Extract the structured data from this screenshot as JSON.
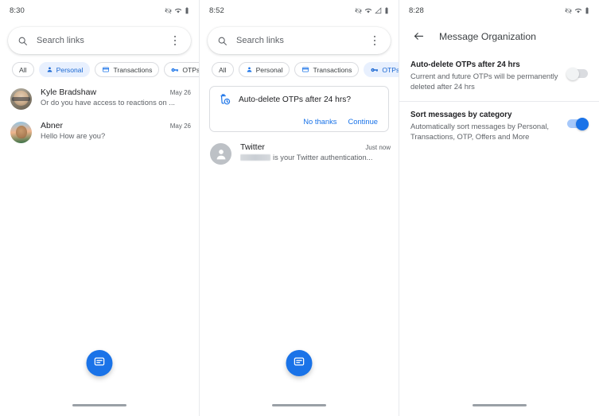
{
  "panels": [
    {
      "status": {
        "time": "8:30",
        "icons": [
          "vibrate-off-icon",
          "wifi-icon",
          "battery-icon"
        ]
      },
      "search": {
        "placeholder": "Search links",
        "value": "",
        "overflow": "more-options"
      },
      "chips": [
        {
          "label": "All",
          "icon": null,
          "selected": false
        },
        {
          "label": "Personal",
          "icon": "person-icon",
          "selected": true
        },
        {
          "label": "Transactions",
          "icon": "credit-card-icon",
          "selected": false
        },
        {
          "label": "OTPs",
          "icon": "key-icon",
          "selected": false
        }
      ],
      "conversations": [
        {
          "name": "Kyle Bradshaw",
          "snippet": "Or do you have access to reactions on ...",
          "time": "May 26",
          "avatar": "photo-kyle"
        },
        {
          "name": "Abner",
          "snippet": "Hello How are you?",
          "time": "May 26",
          "avatar": "photo-abner"
        }
      ],
      "fab": "compose-message-icon"
    },
    {
      "status": {
        "time": "8:52",
        "icons": [
          "vibrate-off-icon",
          "wifi-icon",
          "signal-icon",
          "battery-icon"
        ]
      },
      "search": {
        "placeholder": "Search links",
        "value": "",
        "overflow": "more-options"
      },
      "chips": [
        {
          "label": "All",
          "icon": null,
          "selected": false
        },
        {
          "label": "Personal",
          "icon": "person-icon",
          "selected": false
        },
        {
          "label": "Transactions",
          "icon": "credit-card-icon",
          "selected": false
        },
        {
          "label": "OTPs",
          "icon": "key-icon",
          "selected": true
        }
      ],
      "promo": {
        "icon": "auto-delete-icon",
        "title": "Auto-delete OTPs after 24 hrs?",
        "dismiss_label": "No thanks",
        "confirm_label": "Continue"
      },
      "conversations": [
        {
          "name": "Twitter",
          "snippet_redacted": true,
          "snippet": "is your Twitter authentication...",
          "time": "Just now",
          "avatar": "generic-person"
        }
      ],
      "fab": "compose-message-icon"
    },
    {
      "status": {
        "time": "8:28",
        "icons": [
          "vibrate-off-icon",
          "wifi-icon",
          "battery-icon"
        ]
      },
      "appbar": {
        "back_icon": "arrow-back-icon",
        "title": "Message Organization"
      },
      "settings": [
        {
          "title": "Auto-delete OTPs after 24 hrs",
          "subtitle": "Current and future OTPs will be permanently deleted after 24 hrs",
          "toggle_state": "off"
        },
        {
          "title": "Sort messages by category",
          "subtitle": "Automatically sort messages by Personal, Transactions, OTP, Offers and More",
          "toggle_state": "on"
        }
      ]
    }
  ],
  "colors": {
    "accent": "#1a73e8",
    "chip_selected_bg": "#e8f0fe",
    "chip_selected_text": "#1967d2",
    "toggle_on_track": "#a6c8fa",
    "toggle_off_track": "#dadce0",
    "text_primary": "#202124",
    "text_secondary": "#5f6368"
  }
}
